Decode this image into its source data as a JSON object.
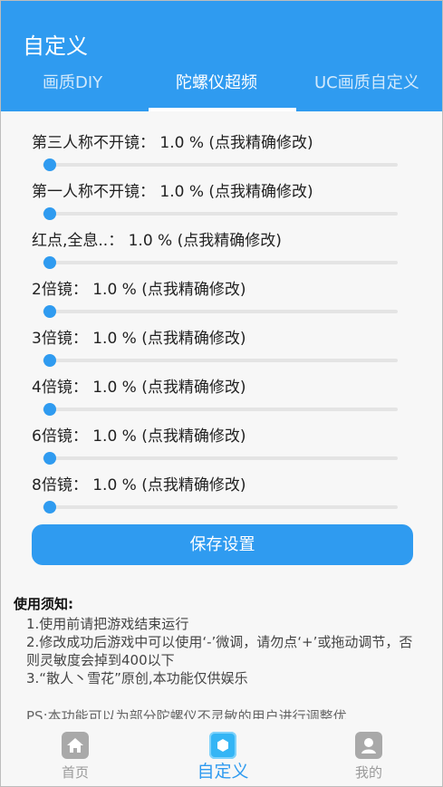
{
  "app": {
    "title": "自定义"
  },
  "tabs": [
    {
      "label": "画质DIY",
      "active": false
    },
    {
      "label": "陀螺仪超频",
      "active": true
    },
    {
      "label": "UC画质自定义",
      "active": false
    }
  ],
  "settings": [
    {
      "label": "第三人称不开镜：  1.0 %  (点我精确修改)",
      "value_percent": 1.0
    },
    {
      "label": "第一人称不开镜：  1.0 %  (点我精确修改)",
      "value_percent": 1.0
    },
    {
      "label": "红点,全息..：  1.0 %  (点我精确修改)",
      "value_percent": 1.0
    },
    {
      "label": "2倍镜：  1.0 %  (点我精确修改)",
      "value_percent": 1.0
    },
    {
      "label": "3倍镜：  1.0 %  (点我精确修改)",
      "value_percent": 1.0
    },
    {
      "label": "4倍镜：  1.0 %  (点我精确修改)",
      "value_percent": 1.0
    },
    {
      "label": "6倍镜：  1.0 %  (点我精确修改)",
      "value_percent": 1.0
    },
    {
      "label": "8倍镜：  1.0 %  (点我精确修改)",
      "value_percent": 1.0
    }
  ],
  "save_button": {
    "label": "保存设置"
  },
  "notice": {
    "title": "使用须知:",
    "lines": [
      "1.使用前请把游戏结束运行",
      "2.修改成功后游戏中可以使用‘-’微调，请勿点‘+’或拖动调节，否则灵敏度会掉到400以下",
      "3.“散人丶雪花”原创,本功能仅供娱乐"
    ],
    "ps": "PS:本功能可以为部分陀螺仪不灵敏的用户进行调整优"
  },
  "bottom_nav": [
    {
      "label": "首页",
      "icon": "home-icon",
      "active": false
    },
    {
      "label": "自定义",
      "icon": "custom-icon",
      "active": true
    },
    {
      "label": "我的",
      "icon": "profile-icon",
      "active": false
    }
  ],
  "colors": {
    "primary": "#2f9bf0",
    "track": "#e4e4e4",
    "inactive": "#9a9a9a"
  }
}
